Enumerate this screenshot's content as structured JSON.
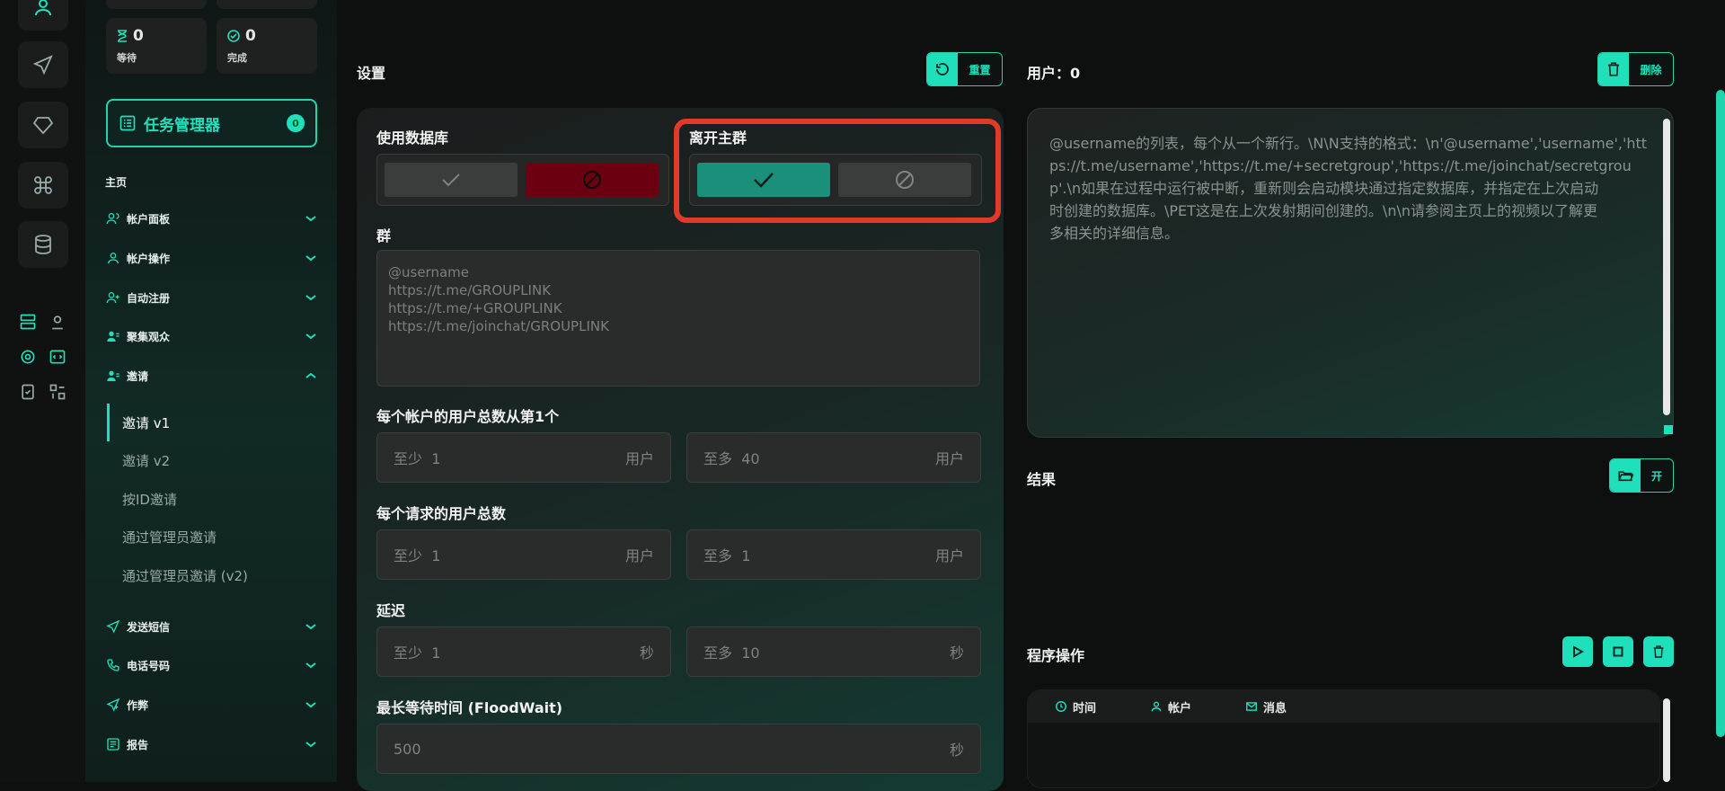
{
  "stats": {
    "waiting": {
      "value": "0",
      "label": "等待"
    },
    "done": {
      "value": "0",
      "label": "完成"
    }
  },
  "task_manager": {
    "label": "任务管理器",
    "count": "0"
  },
  "sidebar": {
    "home_label": "主页",
    "items": [
      {
        "label": "帐户面板"
      },
      {
        "label": "帐户操作"
      },
      {
        "label": "自动注册"
      },
      {
        "label": "聚集观众"
      },
      {
        "label": "邀请"
      },
      {
        "label": "发送短信"
      },
      {
        "label": "电话号码"
      },
      {
        "label": "作弊"
      },
      {
        "label": "报告"
      }
    ],
    "invite_sub": [
      {
        "label": "邀请 v1"
      },
      {
        "label": "邀请 v2"
      },
      {
        "label": "按ID邀请"
      },
      {
        "label": "通过管理员邀请"
      },
      {
        "label": "通过管理员邀请 (v2)"
      }
    ]
  },
  "settings": {
    "title": "设置",
    "reset_label": "重置",
    "use_db_label": "使用数据库",
    "leave_group_label": "离开主群",
    "group_label": "群",
    "group_placeholder": "@username\nhttps://t.me/GROUPLINK\nhttps://t.me/+GROUPLINK\nhttps://t.me/joinchat/GROUPLINK",
    "users_per_account_label": "每个帐户的用户总数从第1个",
    "users_per_account_min": {
      "prefix": "至少",
      "value": "1",
      "unit": "用户"
    },
    "users_per_account_max": {
      "prefix": "至多",
      "value": "40",
      "unit": "用户"
    },
    "users_per_request_label": "每个请求的用户总数",
    "users_per_request_min": {
      "prefix": "至少",
      "value": "1",
      "unit": "用户"
    },
    "users_per_request_max": {
      "prefix": "至多",
      "value": "1",
      "unit": "用户"
    },
    "delay_label": "延迟",
    "delay_min": {
      "prefix": "至少",
      "value": "1",
      "unit": "秒"
    },
    "delay_max": {
      "prefix": "至多",
      "value": "10",
      "unit": "秒"
    },
    "floodwait_label": "最长等待时间 (FloodWait)",
    "floodwait_value": {
      "value": "500",
      "unit": "秒"
    }
  },
  "users": {
    "title": "用户：0",
    "delete_label": "删除",
    "placeholder_lines": [
      "@username的列表，每个从一个新行。\\N\\N支持的格式：\\n'@username','username','htt",
      "ps://t.me/username','https://t.me/+secretgroup','https://t.me/joinchat/secretgrou",
      "p'.\\n如果在过程中运行被中断，重新则会启动模块通过指定数据库，并指定在上次启动",
      "时创建的数据库。\\PET这是在上次发射期间创建的。\\n\\n请参阅主页上的视频以了解更",
      "多相关的详细信息。"
    ]
  },
  "results": {
    "title": "结果",
    "open_label": "开"
  },
  "program": {
    "title": "程序操作",
    "log_columns": [
      "时间",
      "帐户",
      "消息"
    ]
  },
  "colors": {
    "accent": "#20e0bb",
    "highlight": "#e23a2a",
    "deny": "#6b0010"
  }
}
